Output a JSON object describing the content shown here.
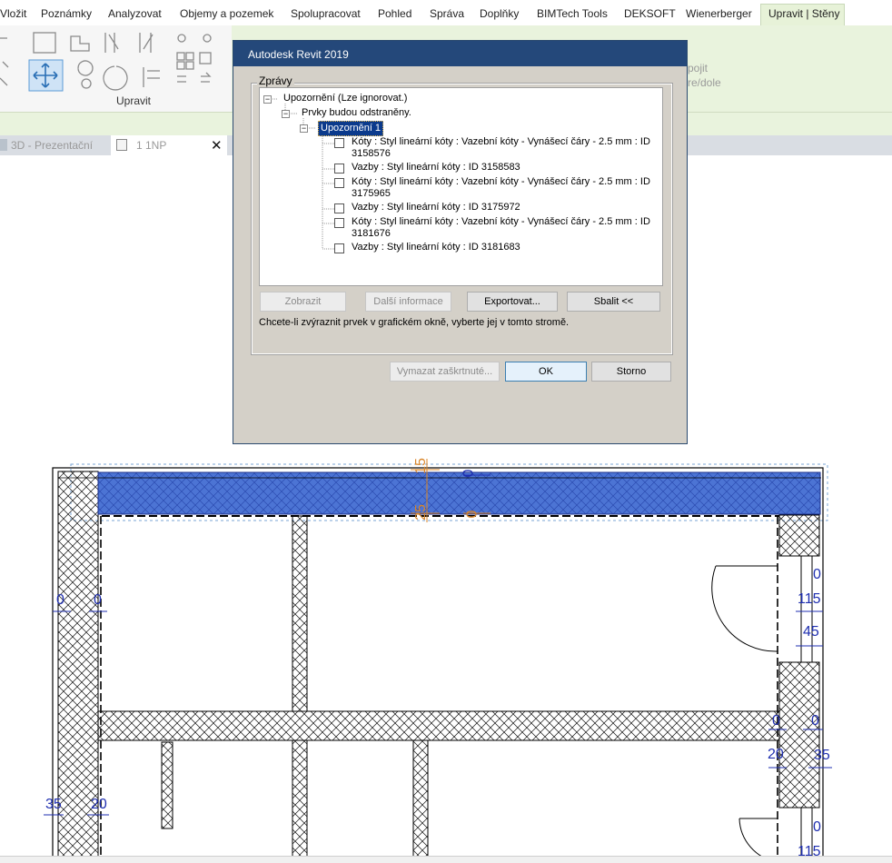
{
  "menu": [
    "Vložit",
    "Poznámky",
    "Analyzovat",
    "Objemy a pozemek",
    "Spolupracovat",
    "Pohled",
    "Správa",
    "Doplňky",
    "BIMTech Tools",
    "DEKSOFT",
    "Wienerberger",
    "Upravit | Stěny"
  ],
  "ribbon": {
    "group_label": "Upravit",
    "partial_label_1": "pojit",
    "partial_label_2": "re/dole"
  },
  "view_tabs": [
    "3D - Prezentační",
    "1 1NP"
  ],
  "dialog": {
    "title": "Autodesk Revit 2019",
    "group_label": "Zprávy",
    "tree": {
      "root": "Upozornění (Lze ignorovat.)",
      "level2": "Prvky budou odstraněny.",
      "level3": "Upozornění 1",
      "items": [
        {
          "line1": "Kóty : Styl lineární kóty : Vazební kóty - Vynášecí čáry - 2.5 mm : ID",
          "line2": "3158576"
        },
        {
          "line1": "Vazby : Styl lineární kóty : ID 3158583",
          "line2": ""
        },
        {
          "line1": "Kóty : Styl lineární kóty : Vazební kóty - Vynášecí čáry - 2.5 mm : ID",
          "line2": "3175965"
        },
        {
          "line1": "Vazby : Styl lineární kóty : ID 3175972",
          "line2": ""
        },
        {
          "line1": "Kóty : Styl lineární kóty : Vazební kóty - Vynášecí čáry - 2.5 mm : ID",
          "line2": "3181676"
        },
        {
          "line1": "Vazby : Styl lineární kóty : ID 3181683",
          "line2": ""
        }
      ]
    },
    "buttons": {
      "show": "Zobrazit",
      "more_info": "Další informace",
      "export": "Exportovat...",
      "collapse": "Sbalit <<",
      "delete_checked": "Vymazat zaškrtnuté...",
      "ok": "OK",
      "cancel": "Storno"
    },
    "hint": "Chcete-li zvýraznit prvek v grafickém okně, vyberte jej v tomto stromě."
  },
  "dims": {
    "d0": "0",
    "d115": "115",
    "d45": "45",
    "d20": "20",
    "d35": "35",
    "d15": "15",
    "d25": "25"
  }
}
